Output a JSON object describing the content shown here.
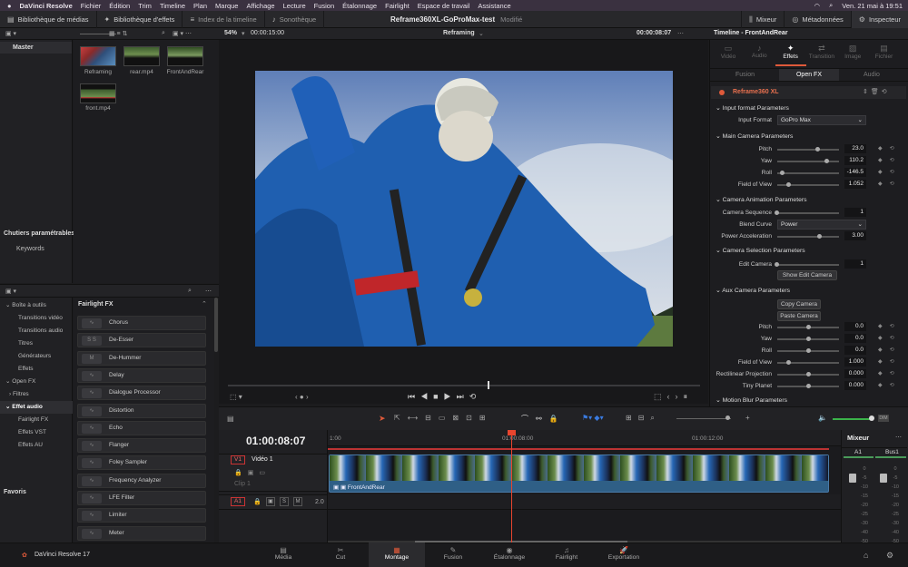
{
  "menubar": {
    "apple": "",
    "app": "DaVinci Resolve",
    "items": [
      "Fichier",
      "Édition",
      "Trim",
      "Timeline",
      "Plan",
      "Marque",
      "Affichage",
      "Lecture",
      "Fusion",
      "Étalonnage",
      "Fairlight",
      "Espace de travail",
      "Assistance"
    ],
    "clock": "Ven. 21 mai à 19:51"
  },
  "toolbar": {
    "media_library": "Bibliothèque de médias",
    "effects_library": "Bibliothèque d'effets",
    "timeline_index": "Index de la timeline",
    "sound_library": "Sonothèque",
    "project_title": "Reframe360XL-GoProMax-test",
    "modified": "Modifié",
    "mixer": "Mixeur",
    "metadata": "Métadonnées",
    "inspector": "Inspecteur"
  },
  "viewer": {
    "zoom": "54%",
    "source_tc": "00:00:15:00",
    "mode": "Reframing",
    "current_tc": "00:00:08:07"
  },
  "left": {
    "master": "Master",
    "smart_bins": "Chutiers paramétrables",
    "keywords": "Keywords"
  },
  "media_pool": {
    "clips": [
      {
        "name": "Reframing"
      },
      {
        "name": "rear.mp4"
      },
      {
        "name": "FrontAndRear"
      },
      {
        "name": "front.mp4"
      }
    ]
  },
  "fx_tree": {
    "toolbox": "Boîte à outils",
    "video_transitions": "Transitions vidéo",
    "audio_transitions": "Transitions audio",
    "titles": "Titres",
    "generators": "Générateurs",
    "effects": "Effets",
    "open_fx": "Open FX",
    "filters": "Filtres",
    "audio_effect": "Effet audio",
    "fairlight_fx": "Fairlight FX",
    "vst": "Effets VST",
    "au": "Effets AU",
    "favorites": "Favoris"
  },
  "fx_list": {
    "header": "Fairlight FX",
    "items": [
      {
        "name": "Chorus",
        "icon": "chorus-icon"
      },
      {
        "name": "De-Esser",
        "icon": "deesser-icon",
        "glyph": "S S"
      },
      {
        "name": "De-Hummer",
        "icon": "dehummer-icon",
        "glyph": "M"
      },
      {
        "name": "Delay",
        "icon": "delay-icon"
      },
      {
        "name": "Dialogue Processor",
        "icon": "dialogue-icon"
      },
      {
        "name": "Distortion",
        "icon": "distortion-icon"
      },
      {
        "name": "Echo",
        "icon": "echo-icon"
      },
      {
        "name": "Flanger",
        "icon": "flanger-icon"
      },
      {
        "name": "Foley Sampler",
        "icon": "foley-icon"
      },
      {
        "name": "Frequency Analyzer",
        "icon": "analyzer-icon"
      },
      {
        "name": "LFE Filter",
        "icon": "lfe-icon"
      },
      {
        "name": "Limiter",
        "icon": "limiter-icon"
      },
      {
        "name": "Meter",
        "icon": "meter-icon"
      }
    ]
  },
  "inspector": {
    "timeline_name": "Timeline - FrontAndRear",
    "tabs": [
      "Vidéo",
      "Audio",
      "Effets",
      "Transition",
      "Image",
      "Fichier"
    ],
    "subtabs": [
      "Fusion",
      "Open FX",
      "Audio"
    ],
    "plugin": "Reframe360 XL",
    "input_format_section": "Input format Parameters",
    "input_format_label": "Input Format",
    "input_format_value": "GoPro Max",
    "main_camera_section": "Main Camera Parameters",
    "main_camera": [
      {
        "label": "Pitch",
        "value": "23.0"
      },
      {
        "label": "Yaw",
        "value": "110.2"
      },
      {
        "label": "Roll",
        "value": "-146.5"
      },
      {
        "label": "Field of View",
        "value": "1.052"
      }
    ],
    "camera_anim_section": "Camera Animation Parameters",
    "camera_sequence_label": "Camera Sequence",
    "camera_sequence_value": "1",
    "blend_curve_label": "Blend Curve",
    "blend_curve_value": "Power",
    "power_accel_label": "Power Acceleration",
    "power_accel_value": "3.00",
    "camera_sel_section": "Camera Selection Parameters",
    "edit_camera_label": "Edit Camera",
    "edit_camera_value": "1",
    "show_edit_camera": "Show Edit Camera",
    "aux_section": "Aux Camera Parameters",
    "copy_camera": "Copy Camera",
    "paste_camera": "Paste Camera",
    "aux_camera": [
      {
        "label": "Pitch",
        "value": "0.0"
      },
      {
        "label": "Yaw",
        "value": "0.0"
      },
      {
        "label": "Roll",
        "value": "0.0"
      },
      {
        "label": "Field of View",
        "value": "1.000"
      },
      {
        "label": "Rectilinear Projection",
        "value": "0.000"
      },
      {
        "label": "Tiny Planet",
        "value": "0.000"
      }
    ],
    "motion_blur_section": "Motion Blur Parameters"
  },
  "timeline": {
    "timecode": "01:00:08:07",
    "ruler": [
      "1:00",
      "01:00:08:00",
      "01:00:12:00"
    ],
    "video_track_id": "V1",
    "video_track_name": "Vidéo 1",
    "video_track_clips": "Clip 1",
    "audio_track_id": "A1",
    "audio_track_level": "2.0",
    "clip_name": "FrontAndRear",
    "track_buttons": [
      "S",
      "M"
    ]
  },
  "mixer": {
    "title": "Mixeur",
    "channels": [
      "A1",
      "Bus1"
    ],
    "scale": [
      "0",
      "-5",
      "-10",
      "-15",
      "-20",
      "-25",
      "-30",
      "-40",
      "-50"
    ]
  },
  "pages": [
    "Média",
    "Cut",
    "Montage",
    "Fusion",
    "Étalonnage",
    "Fairlight",
    "Exportation"
  ],
  "active_page": "Montage",
  "brand": "DaVinci Resolve 17",
  "colors": {
    "accent": "#e05a3a",
    "playhead": "#e8452e",
    "track_blue": "#2f5f86"
  }
}
